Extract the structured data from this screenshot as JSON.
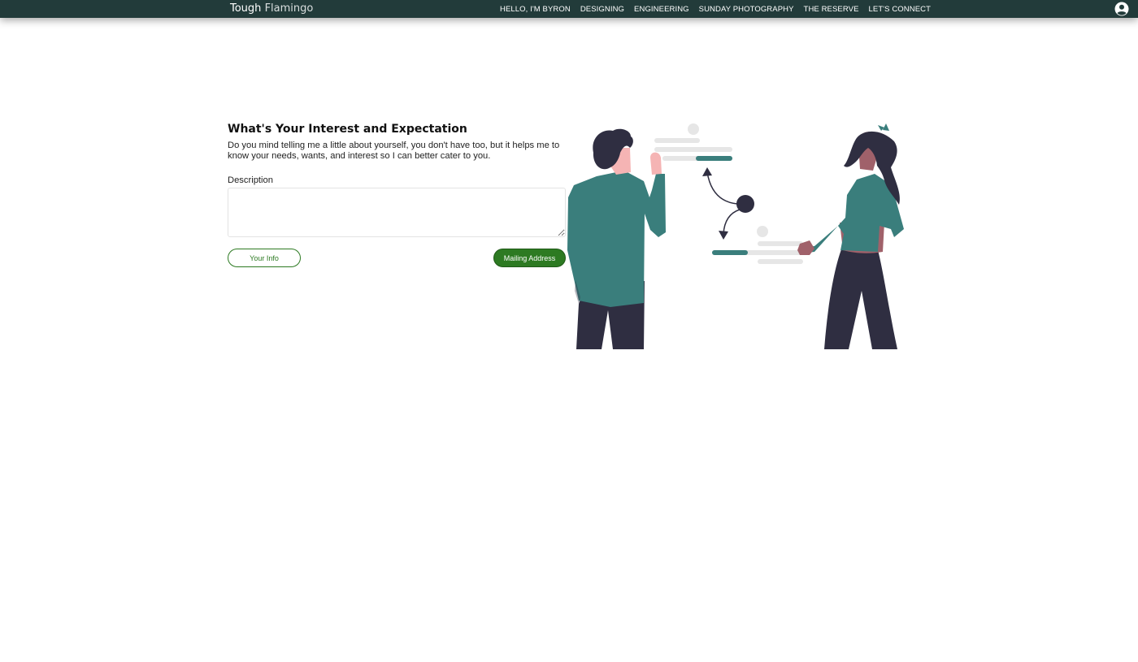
{
  "header": {
    "brand_first": "Tough",
    "brand_second": "Flamingo",
    "nav": [
      {
        "label": "HELLO, I'M BYRON"
      },
      {
        "label": "DESIGNING"
      },
      {
        "label": "ENGINEERING"
      },
      {
        "label": "SUNDAY PHOTOGRAPHY"
      },
      {
        "label": "THE RESERVE"
      },
      {
        "label": "LET'S CONNECT"
      }
    ],
    "account_icon": "account-circle-icon",
    "bar_color": "#223b3a"
  },
  "form": {
    "title": "What's Your Interest and Expectation",
    "intro": "Do you mind telling me a little about yourself, you don't have too, but it helps me to know your needs, wants, and interest so I can better cater to you.",
    "description_label": "Description",
    "description_value": "",
    "back_button": "Your Info",
    "next_button": "Mailing Address",
    "accent_color": "#2d7a22"
  },
  "illustration": {
    "icon": "two-people-collaborating-illustration",
    "shirt_color": "#3a7e7c",
    "dark_color": "#2f2e41"
  }
}
